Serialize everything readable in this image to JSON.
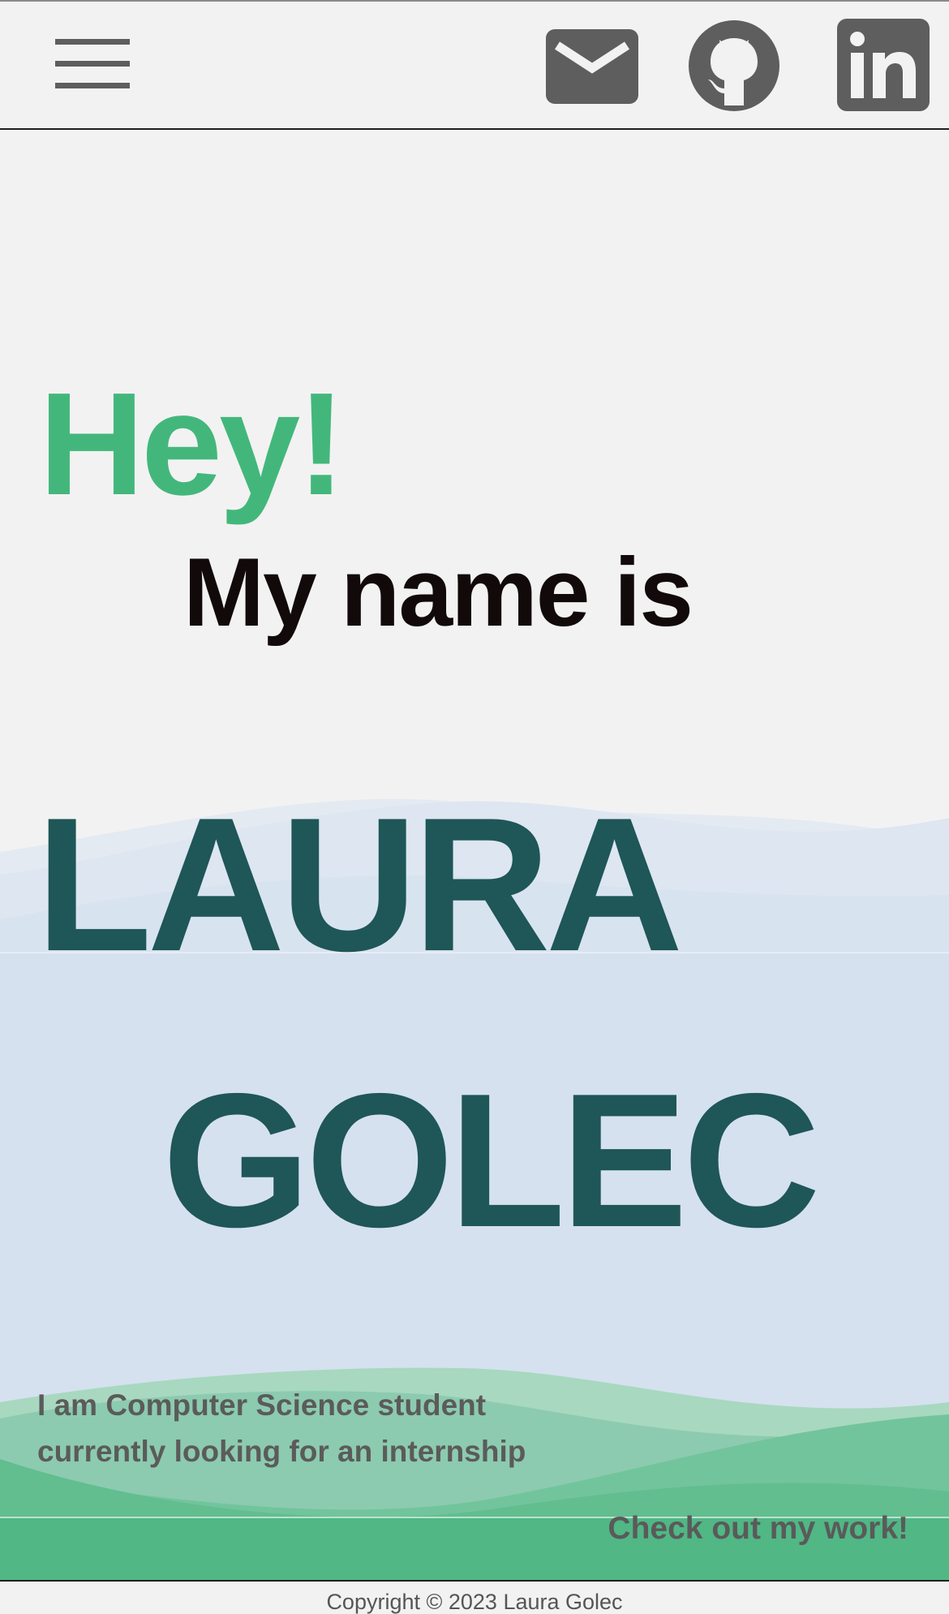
{
  "navbar": {
    "menu_icon": "hamburger-menu-icon",
    "social_icons": [
      "mail-icon",
      "github-icon",
      "linkedin-icon"
    ]
  },
  "hero": {
    "greeting": "Hey!",
    "intro_line": "My name is",
    "first_name": "LAURA",
    "last_name": "GOLEC",
    "description": "I am Computer Science student currently looking for an internship",
    "cta": "Check out my work!"
  },
  "footer": {
    "copyright": "Copyright © 2023 Laura Golec"
  },
  "colors": {
    "background": "#f2f2f2",
    "accent_green": "#43b77b",
    "name_teal": "#1f5657",
    "wave_blue": "#d5e1ef",
    "icon_gray": "#5e5e5e"
  }
}
